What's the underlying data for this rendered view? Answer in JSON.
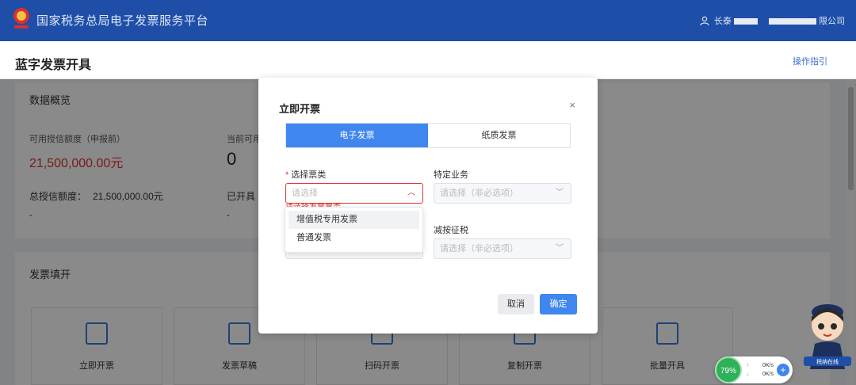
{
  "header": {
    "app_title": "国家税务总局电子发票服务平台",
    "user_name": "长泰",
    "company": "限公司"
  },
  "page": {
    "title": "蓝字发票开具",
    "guide_link": "操作指引"
  },
  "overview": {
    "title": "数据概览",
    "credit_label": "可用授信额度（申报前）",
    "credit_value": "21,500,000.00元",
    "current_label": "当前可用",
    "current_value": "0",
    "total_label": "总授信额度：",
    "total_value": "21,500,000.00元",
    "issued_label": "已开具",
    "dash": "-"
  },
  "invoice_fill": {
    "title": "发票填开",
    "functions": [
      {
        "label": "立即开票",
        "icon": "instant-invoice-icon"
      },
      {
        "label": "发票草稿",
        "icon": "draft-icon"
      },
      {
        "label": "扫码开票",
        "icon": "scan-icon"
      },
      {
        "label": "复制开票",
        "icon": "copy-icon"
      },
      {
        "label": "批量开具",
        "icon": "batch-icon"
      }
    ]
  },
  "modal": {
    "title": "立即开票",
    "close": "×",
    "tabs": [
      {
        "label": "电子发票",
        "active": true
      },
      {
        "label": "纸质发票",
        "active": false
      }
    ],
    "invoice_type": {
      "label": "选择票类",
      "required": "*",
      "placeholder": "请选择",
      "error": "请选择发票票类"
    },
    "special_business": {
      "label": "特定业务",
      "placeholder": "请选择（非必选项）"
    },
    "tax_reduction": {
      "label": "减按征税",
      "placeholder": "请选择（非必选项）"
    },
    "dropdown_options": [
      "增值税专用发票",
      "普通发票"
    ],
    "cancel_label": "取消",
    "ok_label": "确定"
  },
  "widgets": {
    "cpu_percent": "79%",
    "upload_speed": "0K/s",
    "download_speed": "0K/s",
    "add_symbol": "+",
    "mascot_label": "税纳在线"
  },
  "colors": {
    "brand_blue": "#1e4ea8",
    "accent": "#3f86ef",
    "error": "#e0322f"
  }
}
